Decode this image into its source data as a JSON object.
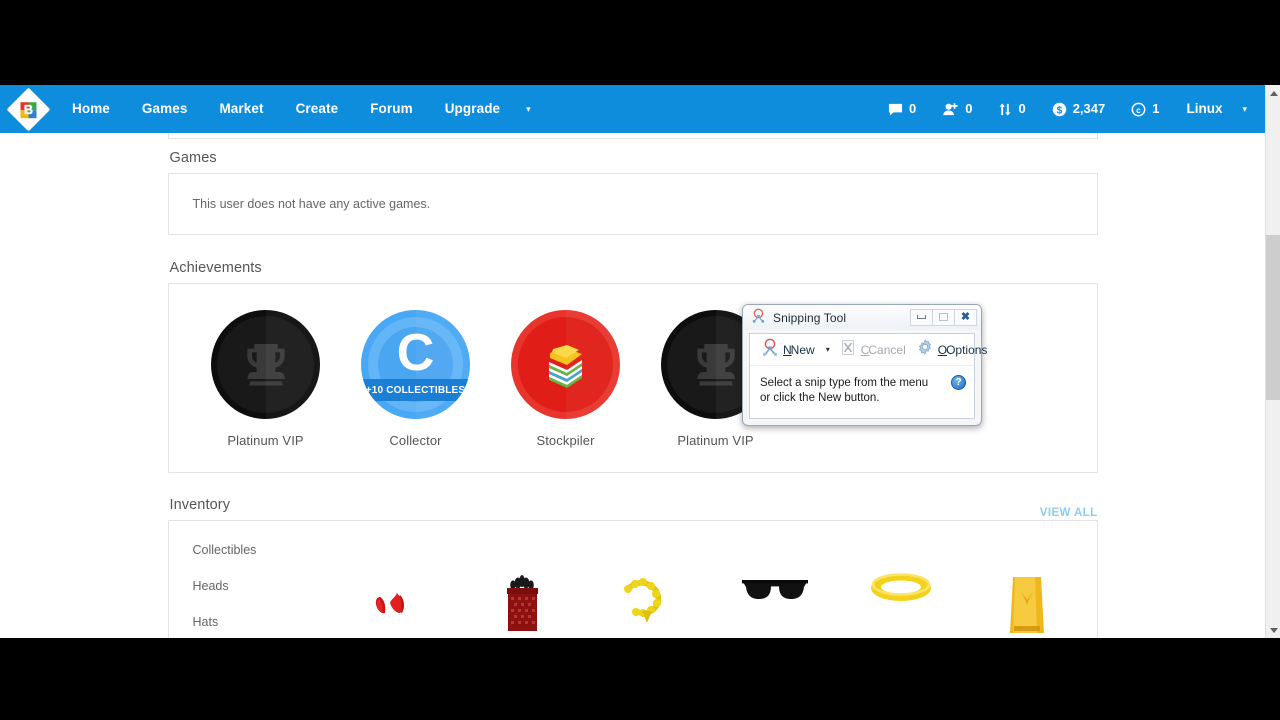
{
  "navbar": {
    "logo_letter": "B",
    "links": [
      {
        "label": "Home"
      },
      {
        "label": "Games"
      },
      {
        "label": "Market"
      },
      {
        "label": "Create"
      },
      {
        "label": "Forum"
      },
      {
        "label": "Upgrade"
      }
    ],
    "caret": "▾",
    "stats": [
      {
        "icon": "messages-icon",
        "value": "0"
      },
      {
        "icon": "friend-requests-icon",
        "value": "0"
      },
      {
        "icon": "trades-icon",
        "value": "0"
      },
      {
        "icon": "currency-bucks-icon",
        "value": "2,347"
      },
      {
        "icon": "currency-coins-icon",
        "value": "1"
      }
    ],
    "username": "Linux",
    "user_caret": "▾",
    "background_color": "#0d8ddb"
  },
  "page": {
    "games": {
      "title": "Games",
      "empty_text": "This user does not have any active games."
    },
    "achievements": {
      "title": "Achievements",
      "items": [
        {
          "label": "Platinum VIP",
          "type": "locked-trophy"
        },
        {
          "label": "Collector",
          "type": "collector",
          "banner": "+10 COLLECTIBLES",
          "letter": "C"
        },
        {
          "label": "Stockpiler",
          "type": "stockpiler"
        },
        {
          "label": "Platinum VIP",
          "type": "locked-trophy"
        }
      ]
    },
    "inventory": {
      "title": "Inventory",
      "view_all": "VIEW ALL",
      "categories": [
        {
          "label": "Collectibles"
        },
        {
          "label": "Heads"
        },
        {
          "label": "Hats"
        }
      ],
      "items": [
        {
          "name": "red-devil-horns-item"
        },
        {
          "name": "red-gift-box-item"
        },
        {
          "name": "gold-chain-item"
        },
        {
          "name": "black-sunglasses-item"
        },
        {
          "name": "yellow-halo-item"
        },
        {
          "name": "yellow-bag-item"
        }
      ]
    }
  },
  "scrollbar": {
    "up_arrow": "▲",
    "down_arrow": "▼"
  },
  "snipping_tool": {
    "title": "Snipping Tool",
    "window_buttons": {
      "minimize": "minimize",
      "maximize": "maximize",
      "close": "✖"
    },
    "toolbar": {
      "new_label_pre": "",
      "new_label": "New",
      "new_accel": "N",
      "dropdown_caret": "▾",
      "cancel_label": "Cancel",
      "cancel_accel": "C",
      "options_label": "Options",
      "options_accel": "O"
    },
    "message_line1": "Select a snip type from the menu",
    "message_line2": "or click the New button.",
    "help_glyph": "?"
  }
}
